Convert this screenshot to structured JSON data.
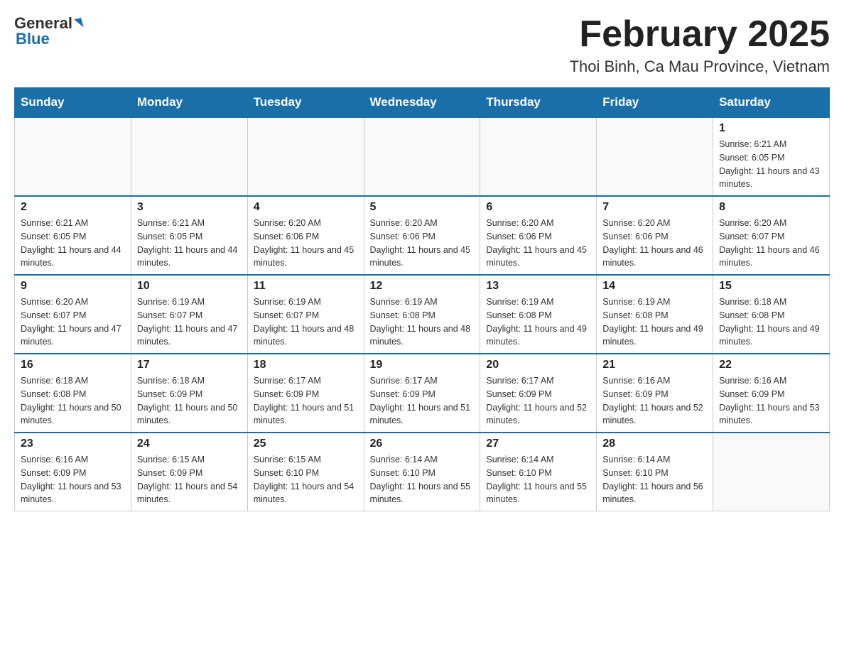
{
  "logo": {
    "general": "General",
    "blue": "Blue"
  },
  "title": "February 2025",
  "subtitle": "Thoi Binh, Ca Mau Province, Vietnam",
  "days_of_week": [
    "Sunday",
    "Monday",
    "Tuesday",
    "Wednesday",
    "Thursday",
    "Friday",
    "Saturday"
  ],
  "weeks": [
    [
      {
        "day": "",
        "sunrise": "",
        "sunset": "",
        "daylight": ""
      },
      {
        "day": "",
        "sunrise": "",
        "sunset": "",
        "daylight": ""
      },
      {
        "day": "",
        "sunrise": "",
        "sunset": "",
        "daylight": ""
      },
      {
        "day": "",
        "sunrise": "",
        "sunset": "",
        "daylight": ""
      },
      {
        "day": "",
        "sunrise": "",
        "sunset": "",
        "daylight": ""
      },
      {
        "day": "",
        "sunrise": "",
        "sunset": "",
        "daylight": ""
      },
      {
        "day": "1",
        "sunrise": "Sunrise: 6:21 AM",
        "sunset": "Sunset: 6:05 PM",
        "daylight": "Daylight: 11 hours and 43 minutes."
      }
    ],
    [
      {
        "day": "2",
        "sunrise": "Sunrise: 6:21 AM",
        "sunset": "Sunset: 6:05 PM",
        "daylight": "Daylight: 11 hours and 44 minutes."
      },
      {
        "day": "3",
        "sunrise": "Sunrise: 6:21 AM",
        "sunset": "Sunset: 6:05 PM",
        "daylight": "Daylight: 11 hours and 44 minutes."
      },
      {
        "day": "4",
        "sunrise": "Sunrise: 6:20 AM",
        "sunset": "Sunset: 6:06 PM",
        "daylight": "Daylight: 11 hours and 45 minutes."
      },
      {
        "day": "5",
        "sunrise": "Sunrise: 6:20 AM",
        "sunset": "Sunset: 6:06 PM",
        "daylight": "Daylight: 11 hours and 45 minutes."
      },
      {
        "day": "6",
        "sunrise": "Sunrise: 6:20 AM",
        "sunset": "Sunset: 6:06 PM",
        "daylight": "Daylight: 11 hours and 45 minutes."
      },
      {
        "day": "7",
        "sunrise": "Sunrise: 6:20 AM",
        "sunset": "Sunset: 6:06 PM",
        "daylight": "Daylight: 11 hours and 46 minutes."
      },
      {
        "day": "8",
        "sunrise": "Sunrise: 6:20 AM",
        "sunset": "Sunset: 6:07 PM",
        "daylight": "Daylight: 11 hours and 46 minutes."
      }
    ],
    [
      {
        "day": "9",
        "sunrise": "Sunrise: 6:20 AM",
        "sunset": "Sunset: 6:07 PM",
        "daylight": "Daylight: 11 hours and 47 minutes."
      },
      {
        "day": "10",
        "sunrise": "Sunrise: 6:19 AM",
        "sunset": "Sunset: 6:07 PM",
        "daylight": "Daylight: 11 hours and 47 minutes."
      },
      {
        "day": "11",
        "sunrise": "Sunrise: 6:19 AM",
        "sunset": "Sunset: 6:07 PM",
        "daylight": "Daylight: 11 hours and 48 minutes."
      },
      {
        "day": "12",
        "sunrise": "Sunrise: 6:19 AM",
        "sunset": "Sunset: 6:08 PM",
        "daylight": "Daylight: 11 hours and 48 minutes."
      },
      {
        "day": "13",
        "sunrise": "Sunrise: 6:19 AM",
        "sunset": "Sunset: 6:08 PM",
        "daylight": "Daylight: 11 hours and 49 minutes."
      },
      {
        "day": "14",
        "sunrise": "Sunrise: 6:19 AM",
        "sunset": "Sunset: 6:08 PM",
        "daylight": "Daylight: 11 hours and 49 minutes."
      },
      {
        "day": "15",
        "sunrise": "Sunrise: 6:18 AM",
        "sunset": "Sunset: 6:08 PM",
        "daylight": "Daylight: 11 hours and 49 minutes."
      }
    ],
    [
      {
        "day": "16",
        "sunrise": "Sunrise: 6:18 AM",
        "sunset": "Sunset: 6:08 PM",
        "daylight": "Daylight: 11 hours and 50 minutes."
      },
      {
        "day": "17",
        "sunrise": "Sunrise: 6:18 AM",
        "sunset": "Sunset: 6:09 PM",
        "daylight": "Daylight: 11 hours and 50 minutes."
      },
      {
        "day": "18",
        "sunrise": "Sunrise: 6:17 AM",
        "sunset": "Sunset: 6:09 PM",
        "daylight": "Daylight: 11 hours and 51 minutes."
      },
      {
        "day": "19",
        "sunrise": "Sunrise: 6:17 AM",
        "sunset": "Sunset: 6:09 PM",
        "daylight": "Daylight: 11 hours and 51 minutes."
      },
      {
        "day": "20",
        "sunrise": "Sunrise: 6:17 AM",
        "sunset": "Sunset: 6:09 PM",
        "daylight": "Daylight: 11 hours and 52 minutes."
      },
      {
        "day": "21",
        "sunrise": "Sunrise: 6:16 AM",
        "sunset": "Sunset: 6:09 PM",
        "daylight": "Daylight: 11 hours and 52 minutes."
      },
      {
        "day": "22",
        "sunrise": "Sunrise: 6:16 AM",
        "sunset": "Sunset: 6:09 PM",
        "daylight": "Daylight: 11 hours and 53 minutes."
      }
    ],
    [
      {
        "day": "23",
        "sunrise": "Sunrise: 6:16 AM",
        "sunset": "Sunset: 6:09 PM",
        "daylight": "Daylight: 11 hours and 53 minutes."
      },
      {
        "day": "24",
        "sunrise": "Sunrise: 6:15 AM",
        "sunset": "Sunset: 6:09 PM",
        "daylight": "Daylight: 11 hours and 54 minutes."
      },
      {
        "day": "25",
        "sunrise": "Sunrise: 6:15 AM",
        "sunset": "Sunset: 6:10 PM",
        "daylight": "Daylight: 11 hours and 54 minutes."
      },
      {
        "day": "26",
        "sunrise": "Sunrise: 6:14 AM",
        "sunset": "Sunset: 6:10 PM",
        "daylight": "Daylight: 11 hours and 55 minutes."
      },
      {
        "day": "27",
        "sunrise": "Sunrise: 6:14 AM",
        "sunset": "Sunset: 6:10 PM",
        "daylight": "Daylight: 11 hours and 55 minutes."
      },
      {
        "day": "28",
        "sunrise": "Sunrise: 6:14 AM",
        "sunset": "Sunset: 6:10 PM",
        "daylight": "Daylight: 11 hours and 56 minutes."
      },
      {
        "day": "",
        "sunrise": "",
        "sunset": "",
        "daylight": ""
      }
    ]
  ]
}
